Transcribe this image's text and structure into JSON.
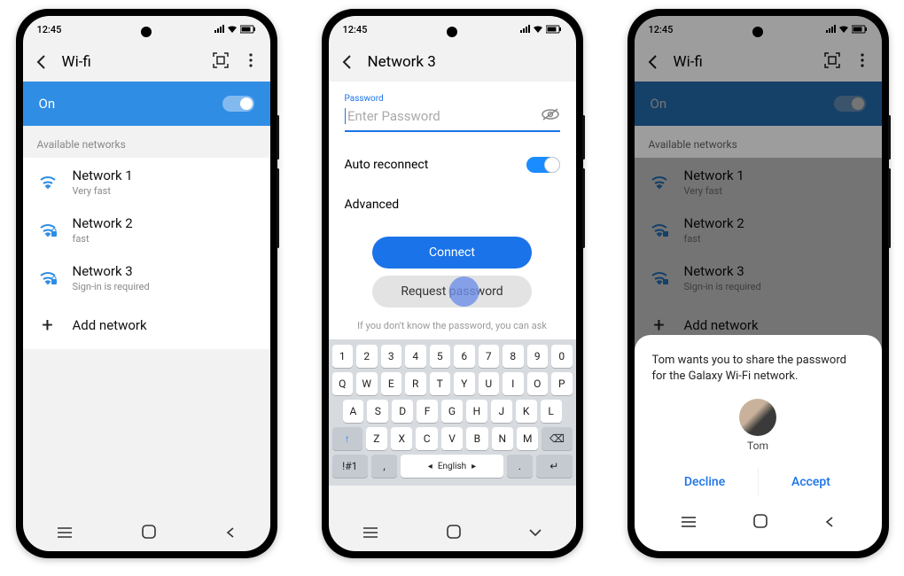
{
  "status": {
    "time": "12:45"
  },
  "screen1": {
    "title": "Wi-fi",
    "toggle_label": "On",
    "section": "Available networks",
    "networks": [
      {
        "name": "Network 1",
        "sub": "Very fast"
      },
      {
        "name": "Network 2",
        "sub": "fast"
      },
      {
        "name": "Network 3",
        "sub": "Sign-in is required"
      }
    ],
    "add": "Add network"
  },
  "screen2": {
    "title": "Network 3",
    "pw_label": "Password",
    "pw_placeholder": "Enter Password",
    "auto": "Auto reconnect",
    "advanced": "Advanced",
    "connect": "Connect",
    "request": "Request password",
    "hint": "If you don't know the password, you can ask",
    "keyboard": {
      "r1": [
        "1",
        "2",
        "3",
        "4",
        "5",
        "6",
        "7",
        "8",
        "9",
        "0"
      ],
      "r2": [
        "Q",
        "W",
        "E",
        "R",
        "T",
        "Y",
        "U",
        "I",
        "O",
        "P"
      ],
      "r3": [
        "A",
        "S",
        "D",
        "F",
        "G",
        "H",
        "J",
        "K",
        "L"
      ],
      "r4": [
        "Z",
        "X",
        "C",
        "V",
        "B",
        "N",
        "M"
      ],
      "shift": "↑",
      "bksp": "⌫",
      "sym": "!#1",
      "lang": "English",
      "enter": "↵"
    }
  },
  "screen3": {
    "title": "Wi-fi",
    "toggle_label": "On",
    "section": "Available networks",
    "networks": [
      {
        "name": "Network 1",
        "sub": "Very fast"
      },
      {
        "name": "Network 2",
        "sub": "fast"
      },
      {
        "name": "Network 3",
        "sub": "Sign-in is required"
      }
    ],
    "add": "Add network",
    "sheet": {
      "text": "Tom wants you to share the password for the Galaxy Wi-Fi network.",
      "name": "Tom",
      "decline": "Decline",
      "accept": "Accept"
    }
  }
}
